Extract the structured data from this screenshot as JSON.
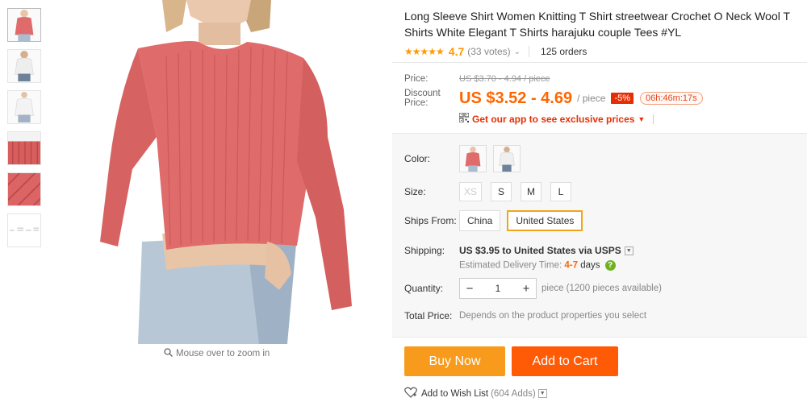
{
  "product": {
    "title": "Long Sleeve Shirt Women Knitting T Shirt streetwear Crochet O Neck Wool T Shirts White Elegant T Shirts harajuku couple Tees #YL",
    "stars": "★★★★★",
    "rating": "4.7",
    "votes": "(33 votes)",
    "orders": "125 orders"
  },
  "gallery": {
    "zoom_hint": "Mouse over to zoom in",
    "thumb_count": 6
  },
  "price": {
    "label": "Price:",
    "original": "US $3.70 - 4.94 / piece",
    "discount_label": "Discount Price:",
    "discount": "US $3.52 - 4.69",
    "unit": "/ piece",
    "percent_off": "-5%",
    "countdown": "06h:46m:17s",
    "app_promo": "Get our app to see exclusive prices"
  },
  "options": {
    "color_label": "Color:",
    "size_label": "Size:",
    "sizes": [
      "XS",
      "S",
      "M",
      "L"
    ],
    "ships_label": "Ships From:",
    "ship_from": [
      "China",
      "United States"
    ],
    "ship_selected": "United States"
  },
  "shipping": {
    "label": "Shipping:",
    "cost": "US $3.95 to United States via USPS",
    "eta_prefix": "Estimated Delivery Time:",
    "eta_days": "4-7",
    "eta_suffix": "days"
  },
  "quantity": {
    "label": "Quantity:",
    "minus": "−",
    "value": "1",
    "plus": "+",
    "available": "piece (1200 pieces available)"
  },
  "total": {
    "label": "Total Price:",
    "note": "Depends on the product properties you select"
  },
  "actions": {
    "buy_now": "Buy Now",
    "add_to_cart": "Add to Cart",
    "wishlist": "Add to Wish List",
    "wish_count": "(604 Adds)"
  },
  "colors": {
    "accent_orange": "#ff6600",
    "buy_now_bg": "#f89b1c",
    "add_to_cart_bg": "#ff5a05",
    "discount_badge": "#e62e04",
    "selected_border": "#f0a51a",
    "shirt_pink": "#e06b6b"
  }
}
